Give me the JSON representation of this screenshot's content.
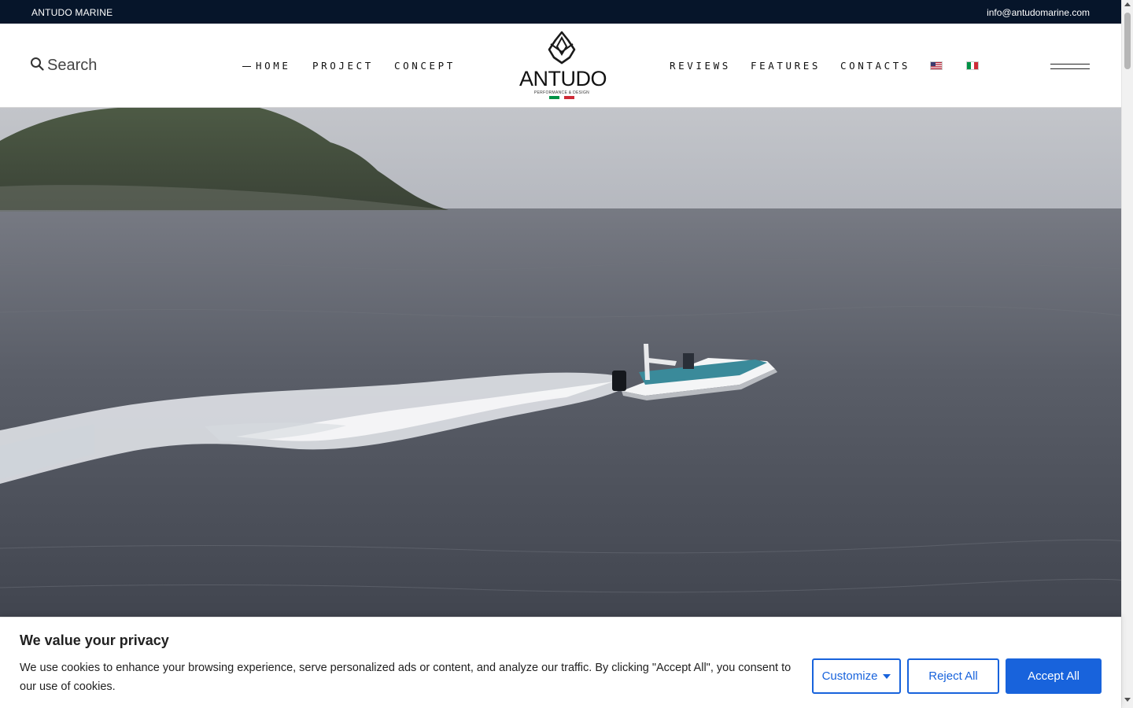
{
  "topbar": {
    "brand": "ANTUDO MARINE",
    "email": "info@antudomarine.com"
  },
  "header": {
    "search_label": "Search",
    "nav_left": [
      "HOME",
      "PROJECT",
      "CONCEPT"
    ],
    "nav_right": [
      "REVIEWS",
      "FEATURES",
      "CONTACTS"
    ],
    "active_item": "HOME",
    "logo": {
      "wordmark": "ANTUDO",
      "tagline": "PERFORMANCE & DESIGN"
    },
    "languages": [
      "English (US flag)",
      "Italian (IT flag)"
    ]
  },
  "hero": {
    "scene": "speedboat wake on sea beside rocky headland"
  },
  "cookie_banner": {
    "title": "We value your privacy",
    "text": "We use cookies to enhance your browsing experience, serve personalized ads or content, and analyze our traffic. By clicking \"Accept All\", you consent to our use of cookies.",
    "customize_label": "Customize",
    "reject_label": "Reject All",
    "accept_label": "Accept All"
  },
  "colors": {
    "topbar_bg": "#06152a",
    "accent_blue": "#1863dc",
    "italy_green": "#009246",
    "italy_red": "#ce2b37"
  },
  "icons": [
    "search-icon",
    "hamburger-menu-icon",
    "antudo-logo-icon",
    "flag-us-icon",
    "flag-it-icon",
    "chevron-down-icon"
  ]
}
